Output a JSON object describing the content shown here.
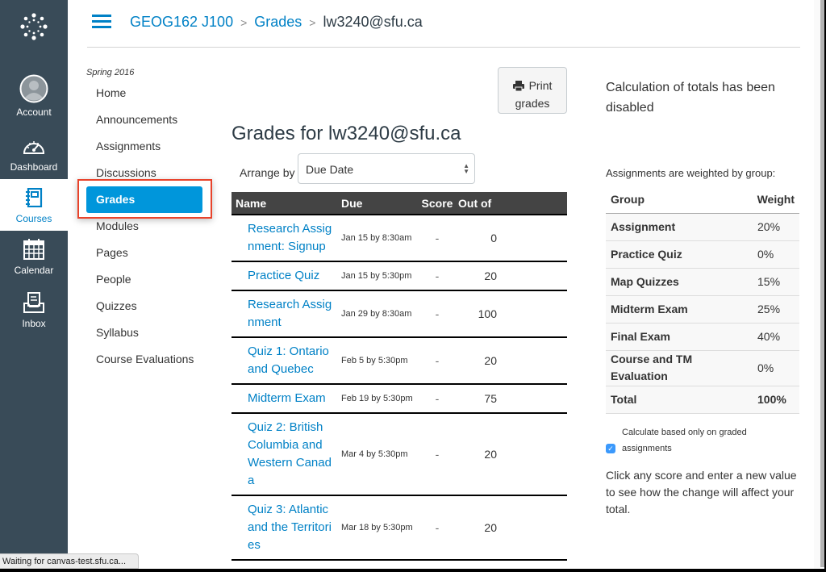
{
  "global_nav": {
    "items": [
      {
        "id": "account",
        "label": "Account",
        "icon": "avatar-icon",
        "active": false
      },
      {
        "id": "dashboard",
        "label": "Dashboard",
        "icon": "speedometer-icon",
        "active": false
      },
      {
        "id": "courses",
        "label": "Courses",
        "icon": "notebook-icon",
        "active": true
      },
      {
        "id": "calendar",
        "label": "Calendar",
        "icon": "calendar-icon",
        "active": false
      },
      {
        "id": "inbox",
        "label": "Inbox",
        "icon": "inbox-icon",
        "active": false
      }
    ],
    "accent_color": "#0081c6",
    "background_color": "#394b58"
  },
  "header": {
    "breadcrumb": [
      {
        "label": "GEOG162 J100",
        "link": true
      },
      {
        "label": "Grades",
        "link": true
      },
      {
        "label": "lw3240@sfu.ca",
        "link": false
      }
    ],
    "separator": ">"
  },
  "course_nav": {
    "term": "Spring 2016",
    "items": [
      {
        "label": "Home",
        "active": false
      },
      {
        "label": "Announcements",
        "active": false
      },
      {
        "label": "Assignments",
        "active": false
      },
      {
        "label": "Discussions",
        "active": false
      },
      {
        "label": "Grades",
        "active": true
      },
      {
        "label": "Modules",
        "active": false
      },
      {
        "label": "Pages",
        "active": false
      },
      {
        "label": "People",
        "active": false
      },
      {
        "label": "Quizzes",
        "active": false
      },
      {
        "label": "Syllabus",
        "active": false
      },
      {
        "label": "Course Evaluations",
        "active": false
      }
    ],
    "active_color": "#0096db",
    "highlight_color": "#e8432b"
  },
  "main": {
    "print_button": {
      "line1": "Print",
      "line2": "grades"
    },
    "title": "Grades for lw3240@sfu.ca",
    "arrange_by": {
      "label": "Arrange by",
      "selected": "Due Date"
    },
    "table": {
      "headers": {
        "name": "Name",
        "due": "Due",
        "score": "Score",
        "out_of": "Out of"
      },
      "rows": [
        {
          "name": "Research Assignment: Signup",
          "due": "Jan 15 by 8:30am",
          "score": "-",
          "out_of": "0"
        },
        {
          "name": "Practice Quiz",
          "due": "Jan 15 by 5:30pm",
          "score": "-",
          "out_of": "20"
        },
        {
          "name": "Research Assignment",
          "due": "Jan 29 by 8:30am",
          "score": "-",
          "out_of": "100"
        },
        {
          "name": "Quiz 1: Ontario and Quebec",
          "due": "Feb 5 by 5:30pm",
          "score": "-",
          "out_of": "20"
        },
        {
          "name": "Midterm Exam",
          "due": "Feb 19 by 5:30pm",
          "score": "-",
          "out_of": "75"
        },
        {
          "name": "Quiz 2: British Columbia and Western Canada",
          "due": "Mar 4 by 5:30pm",
          "score": "-",
          "out_of": "20"
        },
        {
          "name": "Quiz 3: Atlantic and the Territories",
          "due": "Mar 18 by 5:30pm",
          "score": "-",
          "out_of": "20"
        }
      ]
    }
  },
  "sidebar": {
    "calc_note": "Calculation of totals has been disabled",
    "weight_caption": "Assignments are weighted by group:",
    "weights": {
      "headers": {
        "group": "Group",
        "weight": "Weight"
      },
      "rows": [
        {
          "group": "Assignment",
          "weight": "20%"
        },
        {
          "group": "Practice Quiz",
          "weight": "0%"
        },
        {
          "group": "Map Quizzes",
          "weight": "15%"
        },
        {
          "group": "Midterm Exam",
          "weight": "25%"
        },
        {
          "group": "Final Exam",
          "weight": "40%"
        },
        {
          "group": "Course and TM Evaluation",
          "weight": "0%"
        }
      ],
      "total": {
        "label": "Total",
        "weight": "100%"
      }
    },
    "only_graded": {
      "line1": "Calculate based only on graded",
      "line2": "assignments",
      "checked": true
    },
    "whatif_note": "Click any score and enter a new value to see how the change will affect your total."
  },
  "status_bar": {
    "text": "Waiting for canvas-test.sfu.ca..."
  }
}
